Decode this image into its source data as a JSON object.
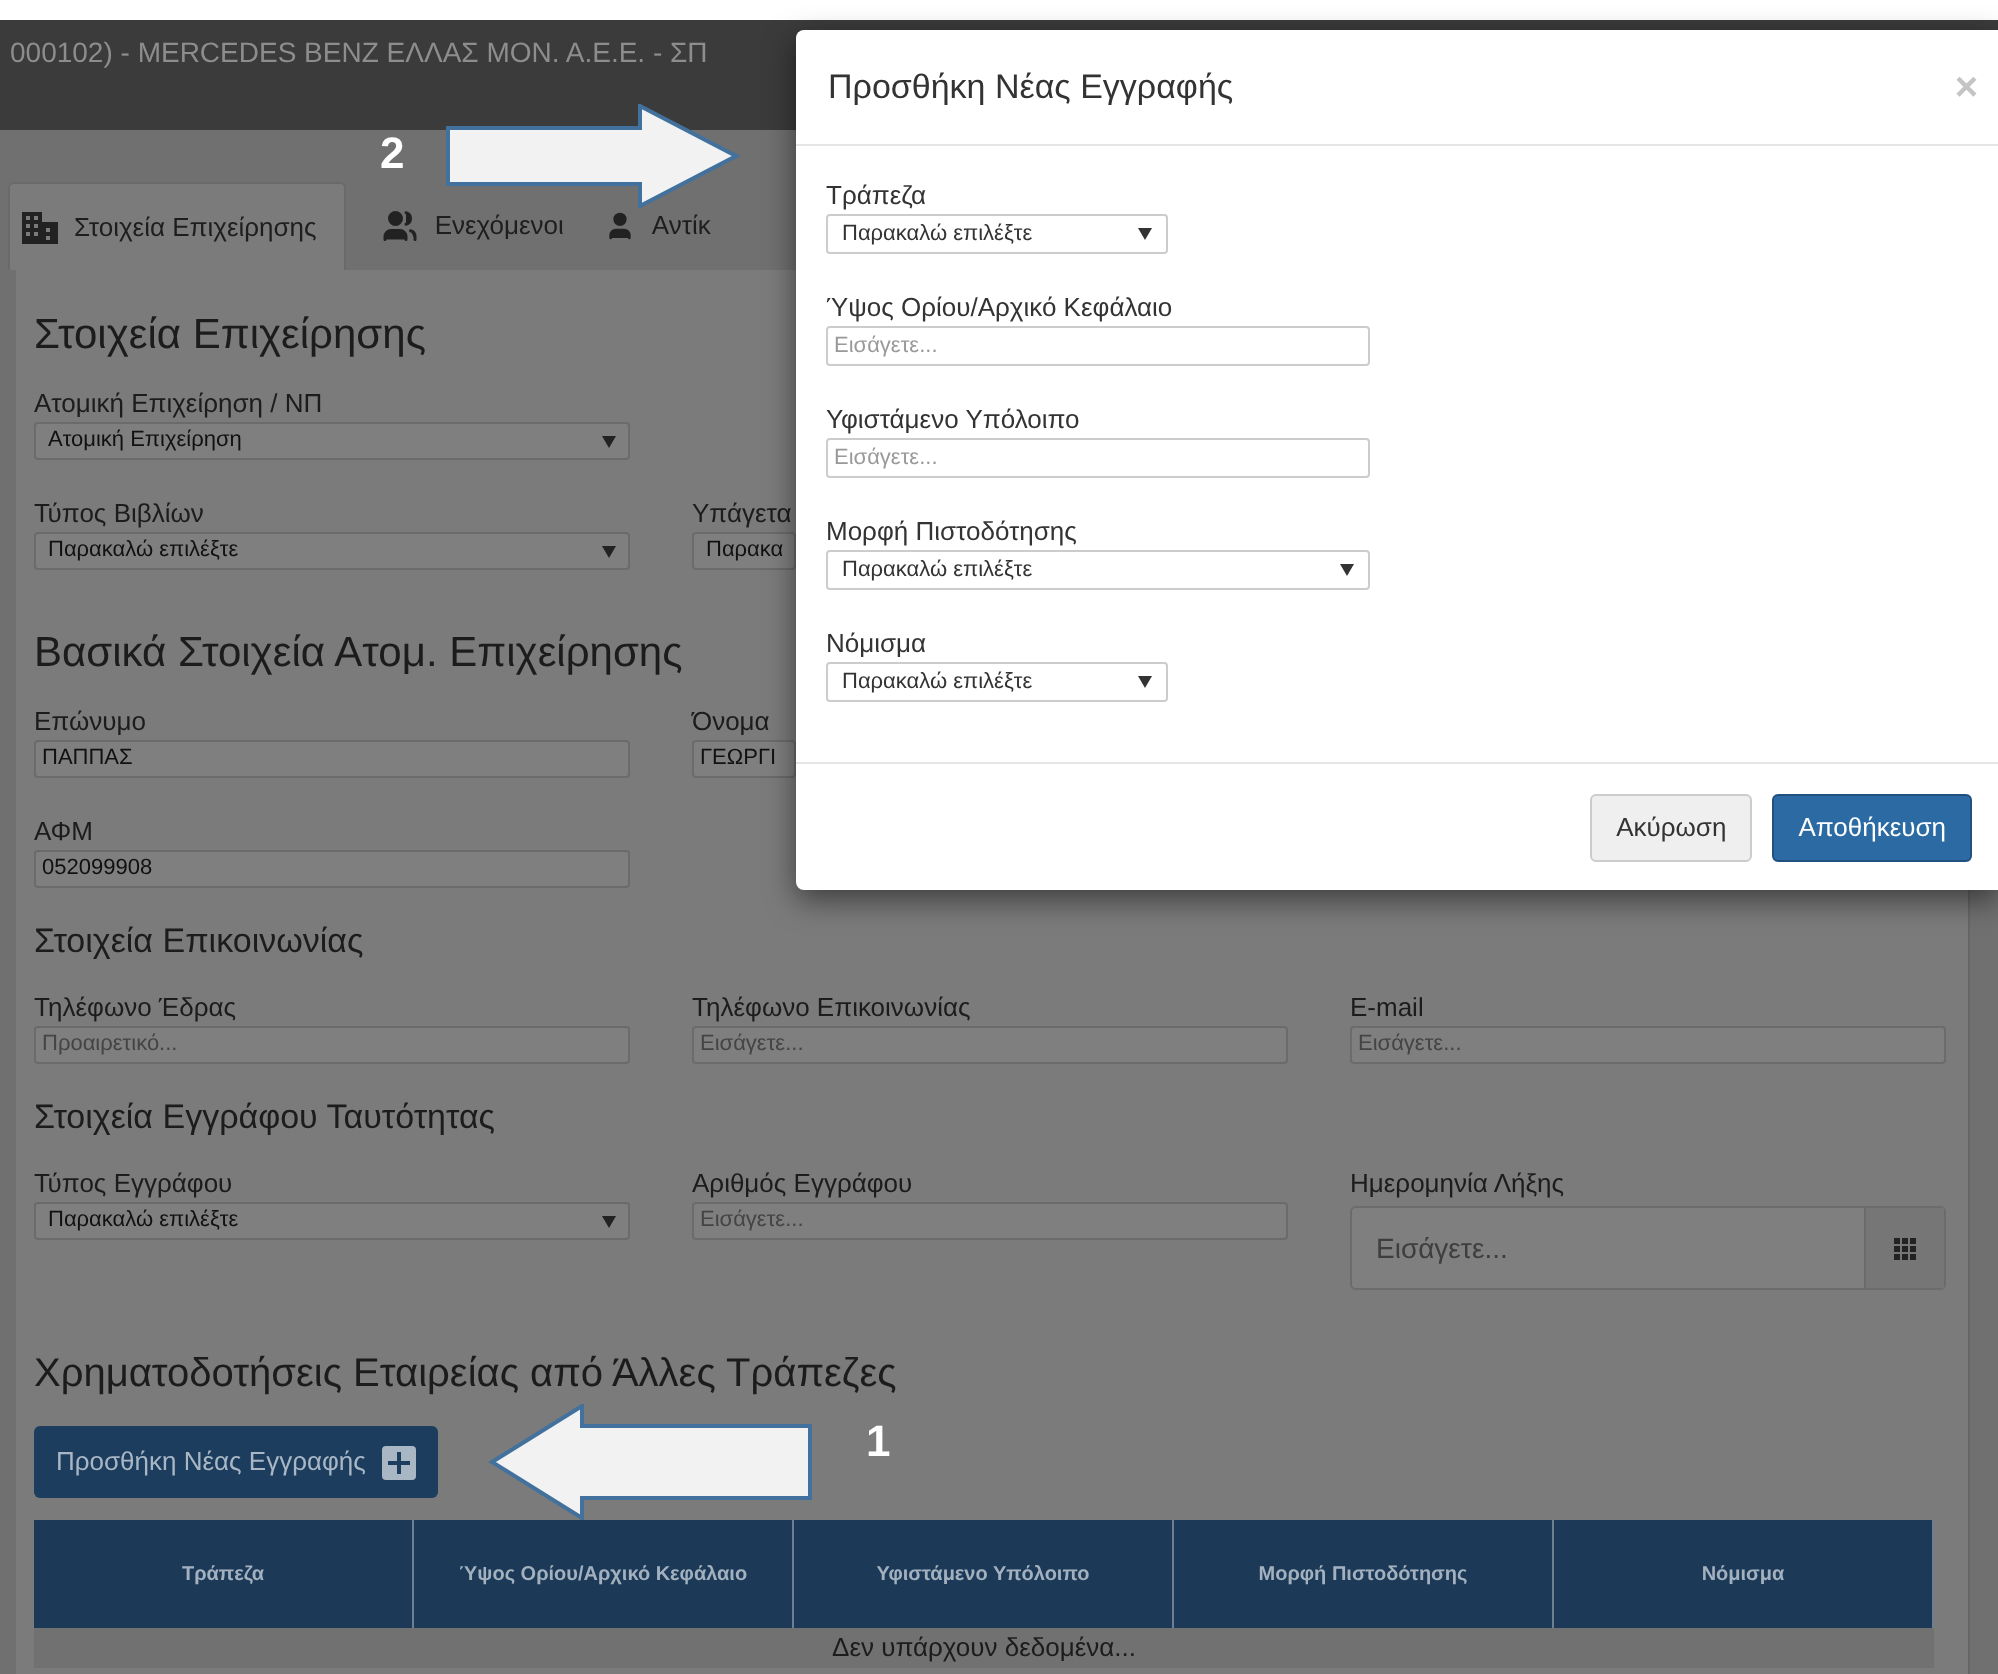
{
  "header": {
    "title": "000102) - MERCEDES BENZ ΕΛΛΑΣ ΜΟΝ. Α.Ε.Ε. - ΣΠ"
  },
  "tabs": [
    {
      "label": "Στοιχεία Επιχείρησης",
      "selected": true
    },
    {
      "label": "Ενεχόμενοι",
      "selected": false
    },
    {
      "label": "Αντίκ",
      "selected": false
    }
  ],
  "sections": [
    {
      "title": "Στοιχεία Επιχείρησης",
      "kind": "major",
      "covered_by_dialog": true,
      "rows": [
        [
          {
            "label": "Ατομική Επιχείρηση / ΝΠ",
            "kind": "select",
            "value": "Ατομική Επιχείρηση"
          }
        ],
        [
          {
            "label": "Τύπος Βιβλίων",
            "kind": "select",
            "value": "Παρακαλώ επιλέξτε"
          },
          {
            "label": "Υπάγετα",
            "kind": "select",
            "value": "Παρακα"
          }
        ]
      ]
    },
    {
      "title": "Βασικά Στοιχεία Ατομ. Επιχείρησης",
      "kind": "major",
      "covered_by_dialog": true,
      "rows": [
        [
          {
            "label": "Επώνυμο",
            "kind": "input",
            "value": "ΠΑΠΠΑΣ"
          },
          {
            "label": "Όνομα",
            "kind": "input",
            "value": "ΓΕΩΡΓΙ"
          }
        ],
        [
          {
            "label": "ΑΦΜ",
            "kind": "input",
            "value": "052099908"
          }
        ]
      ]
    },
    {
      "title": "Στοιχεία Επικοινωνίας",
      "kind": "minor",
      "covered_by_dialog": false,
      "rows": [
        [
          {
            "label": "Τηλέφωνο Έδρας",
            "kind": "input",
            "placeholder": "Προαιρετικό..."
          },
          {
            "label": "Τηλέφωνο Επικοινωνίας",
            "kind": "input",
            "placeholder": "Εισάγετε..."
          },
          {
            "label": "E-mail",
            "kind": "input",
            "placeholder": "Εισάγετε..."
          }
        ]
      ]
    },
    {
      "title": "Στοιχεία Εγγράφου Ταυτότητας",
      "kind": "minor",
      "covered_by_dialog": false,
      "rows": [
        [
          {
            "label": "Τύπος Εγγράφου",
            "kind": "select",
            "value": "Παρακαλώ επιλέξτε"
          },
          {
            "label": "Αριθμός Εγγράφου",
            "kind": "input",
            "placeholder": "Εισάγετε..."
          },
          {
            "label": "Ημερομηνία Λήξης",
            "kind": "date",
            "placeholder": "Εισάγετε..."
          }
        ]
      ]
    }
  ],
  "financing": {
    "title": "Χρηματοδοτήσεις Εταιρείας από Άλλες Τράπεζες",
    "add_button": "Προσθήκη Νέας Εγγραφής",
    "table": {
      "columns": [
        "Τράπεζα",
        "Ύψος Ορίου/Αρχικό Κεφάλαιο",
        "Υφιστάμενο Υπόλοιπο",
        "Μορφή Πιστοδότησης",
        "Νόμισμα"
      ],
      "empty_text": "Δεν υπάρχουν δεδομένα..."
    }
  },
  "dialog": {
    "title": "Προσθήκη Νέας Εγγραφής",
    "close": "×",
    "fields": [
      {
        "label": "Τράπεζα",
        "kind": "short-select",
        "value": "Παρακαλώ επιλέξτε"
      },
      {
        "label": "Ύψος Ορίου/Αρχικό Κεφάλαιο",
        "kind": "input",
        "placeholder": "Εισάγετε..."
      },
      {
        "label": "Υφιστάμενο Υπόλοιπο",
        "kind": "input",
        "placeholder": "Εισάγετε..."
      },
      {
        "label": "Μορφή Πιστοδότησης",
        "kind": "select",
        "value": "Παρακαλώ επιλέξτε"
      },
      {
        "label": "Νόμισμα",
        "kind": "short-select",
        "value": "Παρακαλώ επιλέξτε"
      }
    ],
    "buttons": [
      {
        "label": "Ακύρωση",
        "kind": "secondary"
      },
      {
        "label": "Αποθήκευση",
        "kind": "primary"
      }
    ]
  },
  "callouts": [
    {
      "number": "2"
    },
    {
      "number": "1"
    }
  ]
}
